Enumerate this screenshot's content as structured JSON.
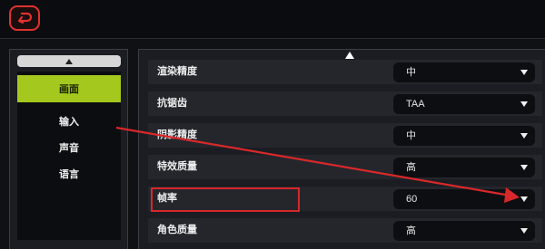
{
  "back_button": {
    "icon": "back-arrow-icon"
  },
  "sidebar": {
    "items": [
      {
        "label": "画面",
        "active": true
      },
      {
        "label": "输入",
        "active": false
      },
      {
        "label": "声音",
        "active": false
      },
      {
        "label": "语言",
        "active": false
      }
    ]
  },
  "settings": [
    {
      "label": "渲染精度",
      "value": "中"
    },
    {
      "label": "抗锯齿",
      "value": "TAA"
    },
    {
      "label": "阴影精度",
      "value": "中"
    },
    {
      "label": "特效质量",
      "value": "高"
    },
    {
      "label": "帧率",
      "value": "60"
    },
    {
      "label": "角色质量",
      "value": "高"
    }
  ],
  "colors": {
    "accent_green": "#a4c81e",
    "accent_red": "#e0322e",
    "annotation_red": "#d8282b"
  }
}
